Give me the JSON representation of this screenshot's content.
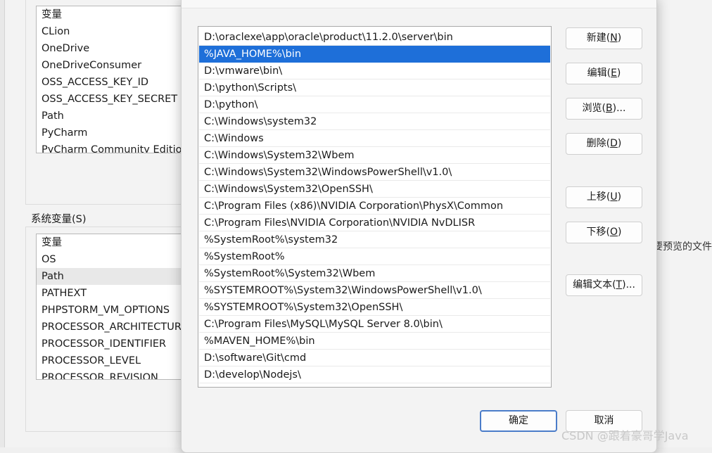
{
  "background": {
    "user_vars_header": "变量",
    "user_vars": [
      "CLion",
      "OneDrive",
      "OneDriveConsumer",
      "OSS_ACCESS_KEY_ID",
      "OSS_ACCESS_KEY_SECRET",
      "Path",
      "PyCharm",
      "PyCharm Community Edition"
    ],
    "system_vars_label": "系统变量(S)",
    "system_vars_header": "变量",
    "system_vars": [
      "OS",
      "Path",
      "PATHEXT",
      "PHPSTORM_VM_OPTIONS",
      "PROCESSOR_ARCHITECTURE",
      "PROCESSOR_IDENTIFIER",
      "PROCESSOR_LEVEL",
      "PROCESSOR_REVISION"
    ],
    "side_text": "要预览的文件"
  },
  "dialog": {
    "paths": [
      "D:\\oraclexe\\app\\oracle\\product\\11.2.0\\server\\bin",
      "%JAVA_HOME%\\bin",
      "D:\\vmware\\bin\\",
      "D:\\python\\Scripts\\",
      "D:\\python\\",
      "C:\\Windows\\system32",
      "C:\\Windows",
      "C:\\Windows\\System32\\Wbem",
      "C:\\Windows\\System32\\WindowsPowerShell\\v1.0\\",
      "C:\\Windows\\System32\\OpenSSH\\",
      "C:\\Program Files (x86)\\NVIDIA Corporation\\PhysX\\Common",
      "C:\\Program Files\\NVIDIA Corporation\\NVIDIA NvDLISR",
      "%SystemRoot%\\system32",
      "%SystemRoot%",
      "%SystemRoot%\\System32\\Wbem",
      "%SYSTEMROOT%\\System32\\WindowsPowerShell\\v1.0\\",
      "%SYSTEMROOT%\\System32\\OpenSSH\\",
      "C:\\Program Files\\MySQL\\MySQL Server 8.0\\bin\\",
      "%MAVEN_HOME%\\bin",
      "D:\\software\\Git\\cmd",
      "D:\\develop\\Nodejs\\"
    ],
    "selected_index": 1,
    "buttons": {
      "new": {
        "text": "新建(",
        "key": "N",
        "end": ")"
      },
      "edit": {
        "text": "编辑(",
        "key": "E",
        "end": ")"
      },
      "browse": {
        "text": "浏览(",
        "key": "B",
        "end": ")..."
      },
      "delete": {
        "text": "删除(",
        "key": "D",
        "end": ")"
      },
      "move_up": {
        "text": "上移(",
        "key": "U",
        "end": ")"
      },
      "move_down": {
        "text": "下移(",
        "key": "O",
        "end": ")"
      },
      "edit_text": {
        "text": "编辑文本(",
        "key": "T",
        "end": ")..."
      },
      "ok": "确定",
      "cancel": "取消"
    }
  },
  "watermark": "CSDN @跟着豪哥学Java"
}
